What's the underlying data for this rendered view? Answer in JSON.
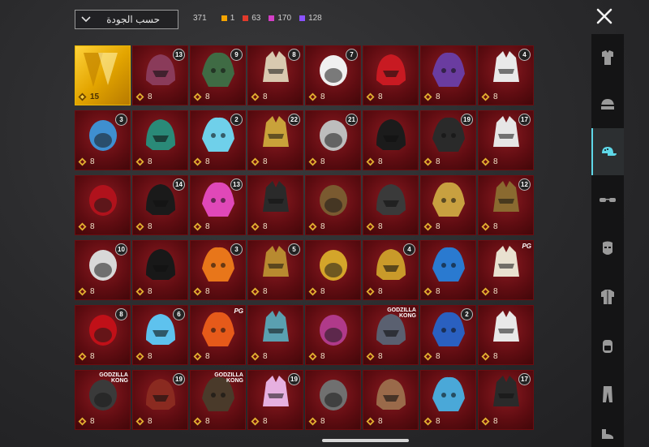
{
  "toolbar": {
    "sort_label": "حسب الجودة",
    "total_count": "371",
    "quality_counts": [
      {
        "color": "#f5a400",
        "value": "1"
      },
      {
        "color": "#e23a2b",
        "value": "63"
      },
      {
        "color": "#d33fc6",
        "value": "170"
      },
      {
        "color": "#8a52ff",
        "value": "128"
      }
    ]
  },
  "sidebar": {
    "items": [
      {
        "icon": "outfit-icon",
        "active": false
      },
      {
        "icon": "helmet-icon",
        "active": false
      },
      {
        "icon": "cap-icon",
        "active": true
      },
      {
        "icon": "glasses-icon",
        "active": false
      },
      {
        "icon": "mask-icon",
        "active": false
      },
      {
        "icon": "shirt-icon",
        "active": false
      },
      {
        "icon": "backpack-icon",
        "active": false
      },
      {
        "icon": "pants-icon",
        "active": false
      },
      {
        "icon": "shoes-icon",
        "active": false
      }
    ]
  },
  "items": [
    {
      "qty": "15",
      "badge": "",
      "brand": "",
      "gold": true,
      "color": "#e8b400",
      "name": "gold-hat-icon"
    },
    {
      "qty": "8",
      "badge": "13",
      "brand": "",
      "color": "#8a3b5a",
      "name": "wide-brim-hat-icon"
    },
    {
      "qty": "8",
      "badge": "9",
      "brand": "",
      "color": "#3f6b44",
      "name": "zombie-head-icon"
    },
    {
      "qty": "8",
      "badge": "8",
      "brand": "",
      "color": "#d9c9b0",
      "name": "blonde-wig-icon"
    },
    {
      "qty": "8",
      "badge": "7",
      "brand": "",
      "color": "#f0f0f0",
      "name": "white-hair-icon"
    },
    {
      "qty": "8",
      "badge": "",
      "brand": "",
      "color": "#c81a22",
      "name": "red-helmet-icon"
    },
    {
      "qty": "8",
      "badge": "",
      "brand": "",
      "color": "#6a3ca0",
      "name": "purple-twin-tails-icon"
    },
    {
      "qty": "8",
      "badge": "4",
      "brand": "",
      "color": "#e9e9e9",
      "name": "snowman-hat-icon"
    },
    {
      "qty": "8",
      "badge": "3",
      "brand": "",
      "color": "#3f8fd0",
      "name": "curly-mask-icon"
    },
    {
      "qty": "8",
      "badge": "",
      "brand": "",
      "color": "#2a8a78",
      "name": "teal-dragon-helmet-icon"
    },
    {
      "qty": "8",
      "badge": "2",
      "brand": "",
      "color": "#6fd0ea",
      "name": "blue-bucket-hat-icon"
    },
    {
      "qty": "8",
      "badge": "22",
      "brand": "",
      "color": "#c9a23a",
      "name": "gold-knight-helmet-icon"
    },
    {
      "qty": "8",
      "badge": "21",
      "brand": "",
      "color": "#bdbdbd",
      "name": "grey-hair-mask-icon"
    },
    {
      "qty": "8",
      "badge": "",
      "brand": "",
      "color": "#1b1b1b",
      "name": "black-red-mask-icon"
    },
    {
      "qty": "8",
      "badge": "19",
      "brand": "",
      "color": "#2a2a2a",
      "name": "black-visor-helmet-icon"
    },
    {
      "qty": "8",
      "badge": "17",
      "brand": "",
      "color": "#e6e6e6",
      "name": "white-braid-hair-icon"
    },
    {
      "qty": "8",
      "badge": "",
      "brand": "",
      "color": "#b0121c",
      "name": "red-round-helmet-icon"
    },
    {
      "qty": "8",
      "badge": "14",
      "brand": "",
      "color": "#1a1a1a",
      "name": "dark-hood-helmet-icon"
    },
    {
      "qty": "8",
      "badge": "13",
      "brand": "",
      "color": "#e048b8",
      "name": "pink-hair-mask-icon"
    },
    {
      "qty": "8",
      "badge": "",
      "brand": "",
      "color": "#2a2a2a",
      "name": "dark-gold-helmet-icon"
    },
    {
      "qty": "8",
      "badge": "",
      "brand": "",
      "color": "#7a5a30",
      "name": "bronze-war-helmet-icon"
    },
    {
      "qty": "8",
      "badge": "",
      "brand": "",
      "color": "#3a3a3a",
      "name": "cat-ear-helmet-icon"
    },
    {
      "qty": "8",
      "badge": "",
      "brand": "",
      "color": "#c8a040",
      "name": "anubis-helmet-icon"
    },
    {
      "qty": "8",
      "badge": "12",
      "brand": "",
      "color": "#8a6a30",
      "name": "pharaoh-helmet-icon"
    },
    {
      "qty": "8",
      "badge": "10",
      "brand": "",
      "color": "#d8d8d8",
      "name": "rooster-hat-icon"
    },
    {
      "qty": "8",
      "badge": "",
      "brand": "",
      "color": "#181818",
      "name": "black-horned-helmet-icon"
    },
    {
      "qty": "8",
      "badge": "3",
      "brand": "",
      "color": "#e8761a",
      "name": "fries-hat-icon"
    },
    {
      "qty": "8",
      "badge": "5",
      "brand": "",
      "color": "#b88a30",
      "name": "gold-cage-helmet-icon"
    },
    {
      "qty": "8",
      "badge": "",
      "brand": "",
      "color": "#d4a52a",
      "name": "gold-spiked-helmet-icon"
    },
    {
      "qty": "8",
      "badge": "4",
      "brand": "",
      "color": "#c99a2a",
      "name": "gold-purple-helmet-icon"
    },
    {
      "qty": "8",
      "badge": "",
      "brand": "",
      "color": "#2a7ad0",
      "name": "jet-hat-icon"
    },
    {
      "qty": "8",
      "badge": "",
      "brand": "PG",
      "color": "#e9e1d0",
      "name": "feather-headdress-icon"
    },
    {
      "qty": "8",
      "badge": "8",
      "brand": "",
      "color": "#c01018",
      "name": "red-samurai-helmet-icon"
    },
    {
      "qty": "8",
      "badge": "6",
      "brand": "",
      "color": "#5ec2ee",
      "name": "ice-block-helmet-icon"
    },
    {
      "qty": "8",
      "badge": "",
      "brand": "PG",
      "color": "#e65a1a",
      "name": "phoenix-helmet-icon"
    },
    {
      "qty": "8",
      "badge": "",
      "brand": "",
      "color": "#5aa0b0",
      "name": "shark-helmet-icon"
    },
    {
      "qty": "8",
      "badge": "",
      "brand": "",
      "color": "#b03a8a",
      "name": "demon-mask-icon"
    },
    {
      "qty": "8",
      "badge": "",
      "brand": "GODZILLA KONG",
      "color": "#5a6070",
      "name": "mecha-godzilla-helmet-icon"
    },
    {
      "qty": "8",
      "badge": "2",
      "brand": "",
      "color": "#2a60c0",
      "name": "blue-dragon-helmet-icon"
    },
    {
      "qty": "8",
      "badge": "",
      "brand": "",
      "color": "#e8e8e8",
      "name": "white-wolf-helmet-icon"
    },
    {
      "qty": "8",
      "badge": "",
      "brand": "GODZILLA KONG",
      "color": "#3a3a3a",
      "name": "godzilla-helmet-icon"
    },
    {
      "qty": "8",
      "badge": "19",
      "brand": "",
      "color": "#8a2a20",
      "name": "oni-horn-helmet-icon"
    },
    {
      "qty": "8",
      "badge": "",
      "brand": "GODZILLA KONG",
      "color": "#4a3a2a",
      "name": "kong-helmet-icon"
    },
    {
      "qty": "8",
      "badge": "19",
      "brand": "",
      "color": "#e6b0e0",
      "name": "pink-dragon-helmet-icon"
    },
    {
      "qty": "8",
      "badge": "",
      "brand": "",
      "color": "#707070",
      "name": "steel-spike-helmet-icon"
    },
    {
      "qty": "8",
      "badge": "",
      "brand": "",
      "color": "#9a6a4a",
      "name": "leather-hood-icon"
    },
    {
      "qty": "8",
      "badge": "",
      "brand": "",
      "color": "#4aa8d8",
      "name": "bird-hat-icon"
    },
    {
      "qty": "8",
      "badge": "17",
      "brand": "",
      "color": "#2a2a2a",
      "name": "black-gold-helmet-icon"
    }
  ]
}
